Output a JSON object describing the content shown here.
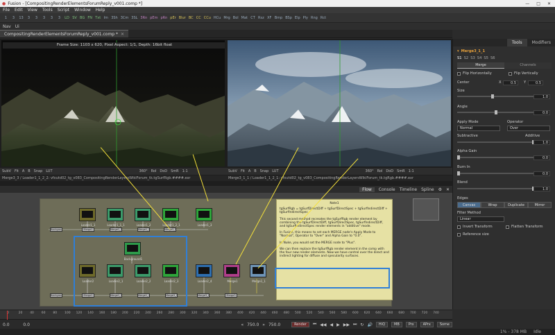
{
  "titlebar": {
    "title": "Fusion - [CompositingRenderElementsForumReply_v001.comp *]",
    "min": "—",
    "max": "□",
    "close": "✕"
  },
  "menu": [
    "File",
    "Edit",
    "View",
    "Tools",
    "Script",
    "Window",
    "Help"
  ],
  "toolbar": [
    "1",
    "3",
    "13",
    "3",
    "3",
    "3",
    "3",
    "3",
    "LD",
    "SV",
    "BG",
    "FN",
    "Txt",
    "Im",
    "3Sh",
    "3Cm",
    "3SL",
    "3Rn",
    "pEm",
    "pRn",
    "pEr",
    "Blur",
    "BC",
    "CC",
    "CCu",
    "HCu",
    "Mrg",
    "Bol",
    "Mat",
    "CT",
    "Rsz",
    "XF",
    "Bmp",
    "BSp",
    "Elp",
    "Ply",
    "Rng",
    "Rct"
  ],
  "subbar": [
    "Nav",
    "Ui"
  ],
  "doctab": {
    "label": "CompositingRenderElementsForumReply_v001.comp *",
    "close": "✕"
  },
  "viewers": {
    "frame_info": "Frame Size: 1103 x 620, Pixel Aspect: 1/1, Depth: 16bit float",
    "left_bar": [
      "SubV",
      "Fit",
      "A",
      "B",
      "Snap",
      "LUT",
      "360°",
      "RoI",
      "DoD",
      "SmR",
      "1:1"
    ],
    "left_caption": "Merge3_3 / Loader1_1_2_2: vfxutd02_tg_v083_CompositingRenderLayersWikiForum_tk.tgSurfRgb.####.exr",
    "right_bar": [
      "SubV",
      "Fit",
      "A",
      "B",
      "Snap",
      "LUT",
      "360°",
      "RoI",
      "DoD",
      "SmR",
      "1:1"
    ],
    "right_caption": "Merge3_1_1 / Loader1_1_2_1: vfxutd02_tg_v083_CompositingRenderLayersWikiForum_tk.tgRgb.####.exr"
  },
  "flow": {
    "tabs": [
      "Flow",
      "Console",
      "Timeline",
      "Spline"
    ],
    "note_title": "Note1",
    "note_paragraphs": [
      "tgSurfRgb = tgSurfDirectDiff + tgSurfDirectSpec + tgSurfIndirectDiff + tgSurfIndirectSpec",
      "This second method recreates the tgSurfRgb render element by combining the tgSurfDirectDiff, tgSurfDirectSpec, tgSurfIndirectDiff, and tgSurfIndirectSpec render elements in \"additive\" mode.",
      "In Fusion, this means to set each MERGE node's Apply Mode to \"Normal\", Operator to \"Over\" and Alpha Gain to \"0.0\".",
      "In Nuke, you would set the MERGE node to \"Plus\".",
      "We can then replace the tgSurfRgb render element in the comp with the four new render elements.  Now we have control over the direct and indirect lighting for diffuse and specularity surfaces."
    ],
    "node_labels": [
      "Loader1_1",
      "Loader1_1_1",
      "Loader1_2",
      "Loader1_2_1",
      "Loader1_3",
      "Merge3_3",
      "Background1",
      "Loader2",
      "Loader2_1",
      "Loader2_2",
      "Loader2_3",
      "Loader2_4",
      "Merge1",
      "Merge1_1",
      "Merge1_2",
      "Merge3_1_1",
      "Merge3_1",
      "Merge3"
    ]
  },
  "timeline": {
    "ruler_ticks": [
      "0",
      "10",
      "20",
      "30",
      "40",
      "50",
      "60",
      "70",
      "80",
      "90",
      "100",
      "110",
      "120",
      "130",
      "140",
      "150",
      "160",
      "170",
      "180",
      "190",
      "200",
      "210",
      "220",
      "230",
      "240",
      "250",
      "260",
      "270",
      "280",
      "290",
      "300",
      "310",
      "320",
      "330",
      "340",
      "350",
      "360",
      "370",
      "380",
      "390",
      "400",
      "410",
      "420",
      "430",
      "440",
      "450",
      "460",
      "470",
      "480",
      "490",
      "500",
      "510",
      "520",
      "530",
      "540",
      "550",
      "560",
      "570",
      "580",
      "590",
      "600",
      "610",
      "620",
      "630",
      "640",
      "650",
      "660",
      "670",
      "680",
      "690",
      "700",
      "710",
      "720",
      "730",
      "740",
      "750"
    ],
    "start": "0.0",
    "current": "0.0",
    "end_a": "750.0",
    "end_b": "750.0",
    "render": "Render",
    "buttons": [
      "HiQ",
      "MB",
      "Prx",
      "APrx",
      "Some"
    ],
    "status_right": "1% - 378 MB",
    "status_idle": "Idle"
  },
  "inspector": {
    "tabs": [
      "Tools",
      "Modifiers"
    ],
    "node_name": "Merge3_1_1",
    "subtabs": [
      "Merge",
      "Channels"
    ],
    "flip_h": "Flip Horizontally",
    "flip_v": "Flip Vertically",
    "center_label": "Center",
    "center_x_label": "X",
    "center_x": "0.5",
    "center_y_label": "Y",
    "center_y": "0.5",
    "size_label": "Size",
    "size_val": "1.0",
    "size_level": 0.45,
    "angle_label": "Angle",
    "angle_val": "0.0",
    "angle_level": 0.5,
    "apply_mode_label": "Apply Mode",
    "apply_mode": "Normal",
    "operator_label": "Operator",
    "operator": "Over",
    "subtractive": "Subtractive",
    "additive": "Additive",
    "add_val": "1.0",
    "additive_level": 1.0,
    "alpha_gain_label": "Alpha Gain",
    "alpha_gain_val": "0.0",
    "alpha_gain_level": 0.0,
    "burn_in_label": "Burn In",
    "burn_in_val": "0.0",
    "burn_in_level": 0.0,
    "blend_label": "Blend",
    "blend_val": "1.0",
    "blend_level": 1.0,
    "edges_label": "Edges",
    "edges": [
      "Canvas",
      "Wrap",
      "Duplicate",
      "Mirror"
    ],
    "filter_label": "Filter Method",
    "filter": "Linear",
    "invert_transform": "Invert Transform",
    "flatten_transform": "Flatten Transform",
    "reference_size": "Reference size"
  }
}
